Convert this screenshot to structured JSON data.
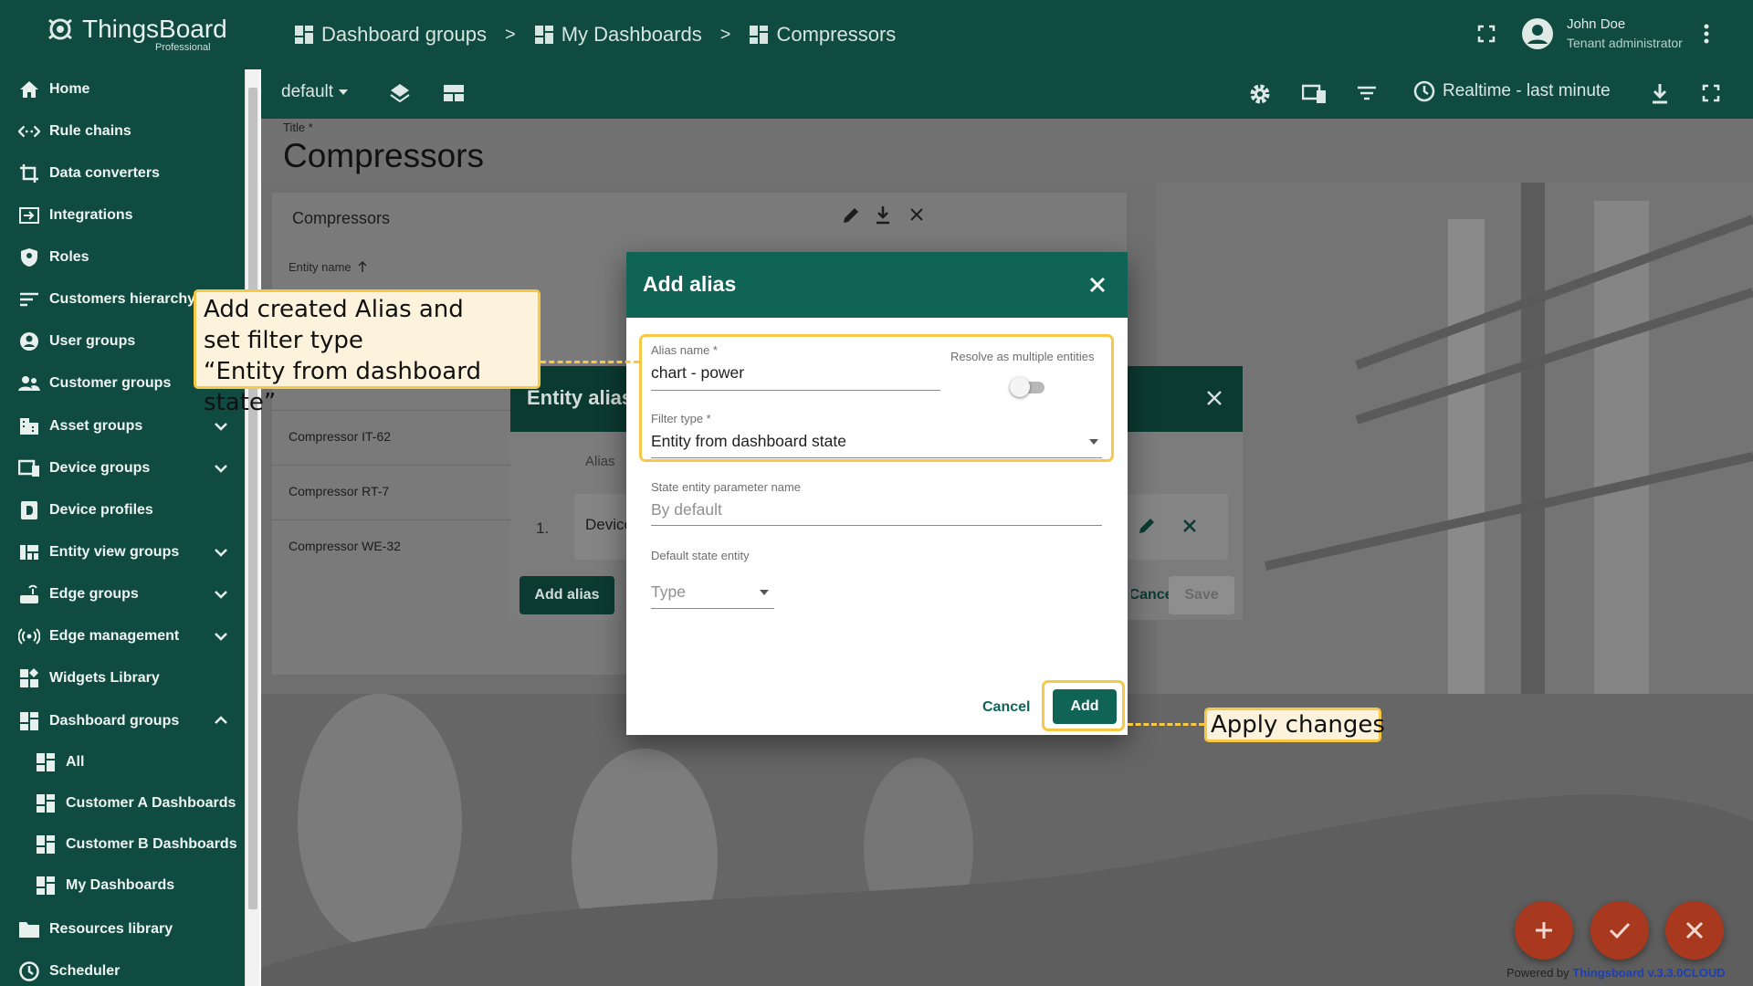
{
  "app": {
    "logo_name": "ThingsBoard",
    "logo_edition": "Professional"
  },
  "breadcrumb": [
    {
      "label": "Dashboard groups"
    },
    {
      "label": "My Dashboards"
    },
    {
      "label": "Compressors"
    }
  ],
  "breadcrumb_separator": ">",
  "user": {
    "name": "John Doe",
    "role": "Tenant administrator"
  },
  "sidebar": {
    "items": [
      {
        "label": "Home",
        "icon": "home-icon"
      },
      {
        "label": "Rule chains",
        "icon": "code-arrows-icon"
      },
      {
        "label": "Data converters",
        "icon": "crop-icon"
      },
      {
        "label": "Integrations",
        "icon": "input-icon"
      },
      {
        "label": "Roles",
        "icon": "shield-icon"
      },
      {
        "label": "Customers hierarchy",
        "icon": "sort-lines-icon"
      },
      {
        "label": "User groups",
        "icon": "account-circle-icon"
      },
      {
        "label": "Customer groups",
        "icon": "people-icon"
      },
      {
        "label": "Asset groups",
        "icon": "domain-icon",
        "expandable": true
      },
      {
        "label": "Device groups",
        "icon": "devices-icon",
        "expandable": true
      },
      {
        "label": "Device profiles",
        "icon": "device-profile-icon"
      },
      {
        "label": "Entity view groups",
        "icon": "view-quilt-icon",
        "expandable": true
      },
      {
        "label": "Edge groups",
        "icon": "router-icon",
        "expandable": true
      },
      {
        "label": "Edge management",
        "icon": "wifi-tethering-icon",
        "expandable": true
      },
      {
        "label": "Widgets Library",
        "icon": "widgets-icon"
      },
      {
        "label": "Dashboard groups",
        "icon": "dashboard-icon",
        "expanded": true
      },
      {
        "label": "All",
        "icon": "dashboard-icon",
        "sub": true
      },
      {
        "label": "Customer A Dashboards",
        "icon": "dashboard-icon",
        "sub": true
      },
      {
        "label": "Customer B Dashboards",
        "icon": "dashboard-icon",
        "sub": true
      },
      {
        "label": "My Dashboards",
        "icon": "dashboard-icon",
        "sub": true
      },
      {
        "label": "Resources library",
        "icon": "folder-icon"
      },
      {
        "label": "Scheduler",
        "icon": "schedule-icon"
      }
    ]
  },
  "toolbar": {
    "state": "default",
    "timewindow": "Realtime - last minute"
  },
  "dashboard": {
    "title_label": "Title *",
    "title": "Compressors"
  },
  "widget": {
    "title": "Compressors",
    "column_header": "Entity name",
    "rows": [
      "Compressor IT-62",
      "Compressor RT-7",
      "Compressor WE-32"
    ]
  },
  "entity_aliases_dialog": {
    "title": "Entity aliases",
    "column_header": "Alias",
    "row_index": "1.",
    "row_value": "Device",
    "add_alias_label": "Add alias",
    "cancel_label": "Cancel",
    "save_label": "Save"
  },
  "add_alias_dialog": {
    "title": "Add alias",
    "alias_name_label": "Alias name *",
    "alias_name_value": "chart - power",
    "resolve_multiple_label": "Resolve as multiple entities",
    "resolve_multiple_on": false,
    "filter_type_label": "Filter type *",
    "filter_type_value": "Entity from dashboard state",
    "state_param_label": "State entity parameter name",
    "state_param_placeholder": "By default",
    "default_state_entity_label": "Default state entity",
    "type_placeholder": "Type",
    "cancel_label": "Cancel",
    "add_label": "Add"
  },
  "callouts": {
    "alias": [
      "Add created Alias and",
      "set filter type",
      "“Entity from dashboard state”"
    ],
    "apply": "Apply changes"
  },
  "footer": {
    "powered_prefix": "Powered by",
    "powered_link": "Thingsboard v.3.3.0CLOUD"
  },
  "colors": {
    "primary": "#0f4b40",
    "dialog_header": "#0f6456",
    "highlight": "#f7c845",
    "fab": "#a8391e"
  }
}
